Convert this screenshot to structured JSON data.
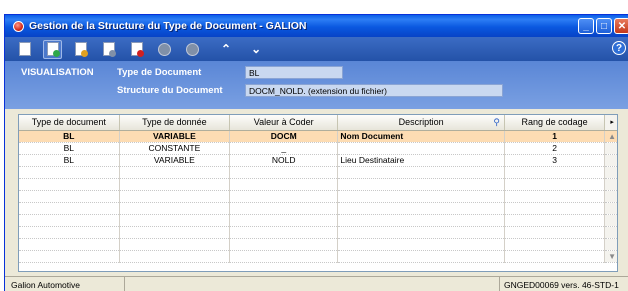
{
  "window": {
    "title": "Gestion de la Structure du Type de Document - GALION"
  },
  "toolbar": {
    "buttons": [
      {
        "icon": "new-document-icon",
        "mark_color": "#ffffff"
      },
      {
        "icon": "add-document-icon",
        "mark_color": "#2fa84a"
      },
      {
        "icon": "edit-document-icon",
        "mark_color": "#e0a020"
      },
      {
        "icon": "copy-document-icon",
        "mark_color": "#8090a8"
      },
      {
        "icon": "delete-document-icon",
        "mark_color": "#d02020"
      },
      {
        "icon": "disabled-circle-icon"
      },
      {
        "icon": "disabled-circle-icon"
      }
    ],
    "nav_up": "^",
    "nav_down": "v",
    "help": "?"
  },
  "header": {
    "mode": "VISUALISATION",
    "type_label": "Type de Document",
    "type_value": "BL",
    "structure_label": "Structure du Document",
    "structure_value": "DOCM_NOLD. (extension du fichier)"
  },
  "grid": {
    "columns": [
      "Type de document",
      "Type de donnée",
      "Valeur à Coder",
      "Description",
      "Rang de codage"
    ],
    "rows": [
      {
        "type_doc": "BL",
        "type_donnee": "VARIABLE",
        "valeur": "DOCM",
        "description": "Nom Document",
        "rang": "1"
      },
      {
        "type_doc": "BL",
        "type_donnee": "CONSTANTE",
        "valeur": "_",
        "description": "",
        "rang": "2"
      },
      {
        "type_doc": "BL",
        "type_donnee": "VARIABLE",
        "valeur": "NOLD",
        "description": "Lieu Destinataire",
        "rang": "3"
      }
    ],
    "selected_row": 0
  },
  "status": {
    "company": "Galion Automotive",
    "version": "GNGED00069 vers. 46-STD-1"
  },
  "colors": {
    "titlebar": "#0a5ee8",
    "header_panel": "#5a86d6",
    "selected_row": "#fddcb3"
  }
}
